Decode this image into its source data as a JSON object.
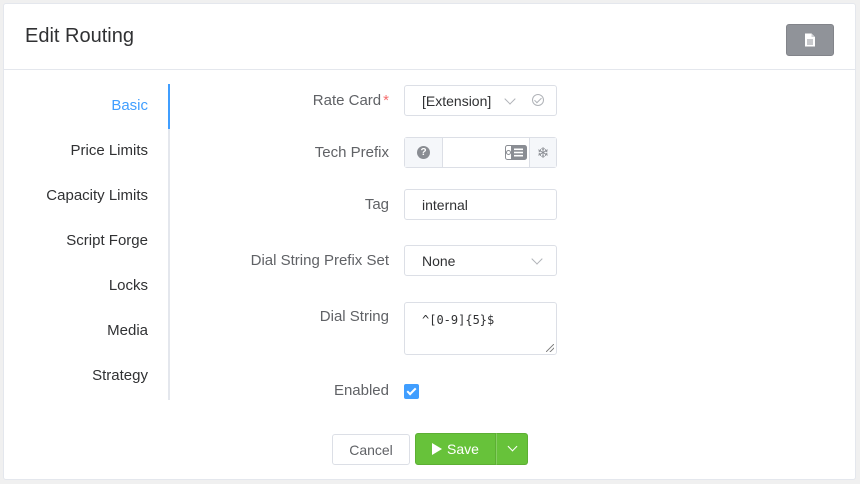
{
  "header": {
    "title": "Edit Routing",
    "doc_icon": "document-icon"
  },
  "sidebar": {
    "items": [
      {
        "label": "Basic",
        "active": true
      },
      {
        "label": "Price Limits"
      },
      {
        "label": "Capacity Limits"
      },
      {
        "label": "Script Forge"
      },
      {
        "label": "Locks"
      },
      {
        "label": "Media"
      },
      {
        "label": "Strategy"
      }
    ]
  },
  "form": {
    "rate_card": {
      "label": "Rate Card",
      "required_mark": "*",
      "value": "[Extension]"
    },
    "tech_prefix": {
      "label": "Tech Prefix",
      "value": "",
      "help_icon": "question-icon",
      "right_icon": "snowflake-icon"
    },
    "tag": {
      "label": "Tag",
      "value": "internal"
    },
    "dial_string_prefix_set": {
      "label": "Dial String Prefix Set",
      "value": "None"
    },
    "dial_string": {
      "label": "Dial String",
      "value": "^[0-9]{5}$"
    },
    "enabled": {
      "label": "Enabled",
      "checked": true
    }
  },
  "footer": {
    "cancel_label": "Cancel",
    "save_label": "Save"
  },
  "colors": {
    "accent": "#409eff",
    "success": "#67c23a",
    "required": "#f56c6c"
  }
}
